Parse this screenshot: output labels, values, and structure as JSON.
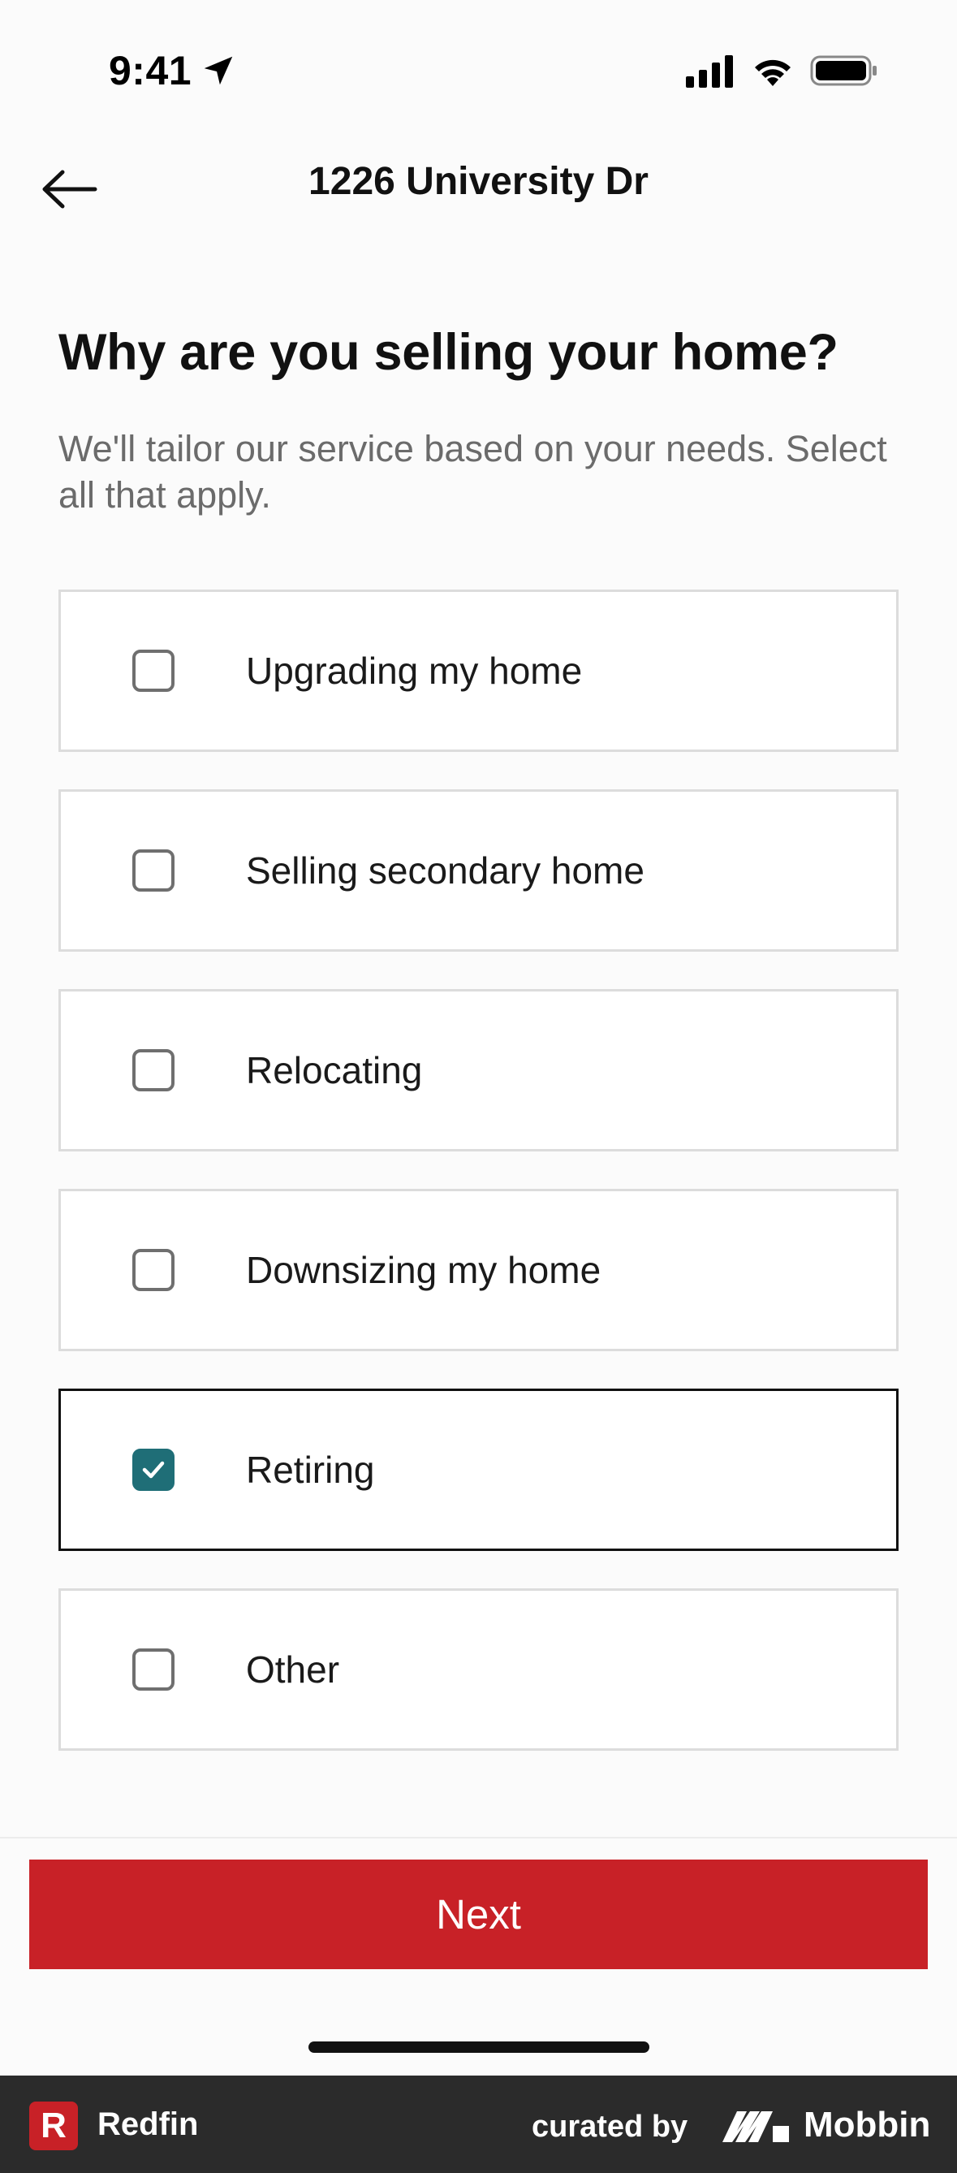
{
  "status_bar": {
    "time": "9:41"
  },
  "header": {
    "title": "1226 University Dr",
    "back_icon": "arrow-left-icon"
  },
  "main": {
    "title": "Why are you selling your home?",
    "subtitle": "We'll tailor our service based on your needs. Select all that apply.",
    "options": [
      {
        "label": "Upgrading my home",
        "checked": false
      },
      {
        "label": "Selling secondary home",
        "checked": false
      },
      {
        "label": "Relocating",
        "checked": false
      },
      {
        "label": "Downsizing my home",
        "checked": false
      },
      {
        "label": "Retiring",
        "checked": true
      },
      {
        "label": "Other",
        "checked": false
      }
    ],
    "next_label": "Next"
  },
  "footer": {
    "app_name": "Redfin",
    "app_logo_letter": "R",
    "curated_by": "curated by",
    "brand": "Mobbin"
  },
  "colors": {
    "accent_red": "#c82127",
    "checkbox_checked": "#1f6e77"
  }
}
